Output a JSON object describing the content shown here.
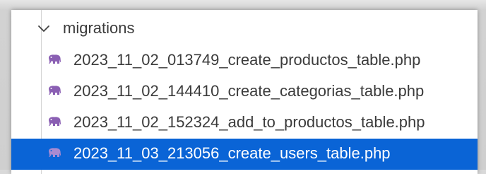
{
  "explorer": {
    "folder": {
      "name": "migrations",
      "expanded": true,
      "icon": "chevron-down-icon"
    },
    "files": [
      {
        "name": "2023_11_02_013749_create_productos_table.php",
        "icon": "php-elephant-icon",
        "selected": false
      },
      {
        "name": "2023_11_02_144410_create_categorias_table.php",
        "icon": "php-elephant-icon",
        "selected": false
      },
      {
        "name": "2023_11_02_152324_add_to_productos_table.php",
        "icon": "php-elephant-icon",
        "selected": false
      },
      {
        "name": "2023_11_03_213056_create_users_table.php",
        "icon": "php-elephant-icon",
        "selected": true
      }
    ]
  },
  "colors": {
    "selection": "#0a64d6",
    "php_icon": "#8a5fb3",
    "text": "#3b3b3b",
    "selected_text": "#ffffff"
  }
}
